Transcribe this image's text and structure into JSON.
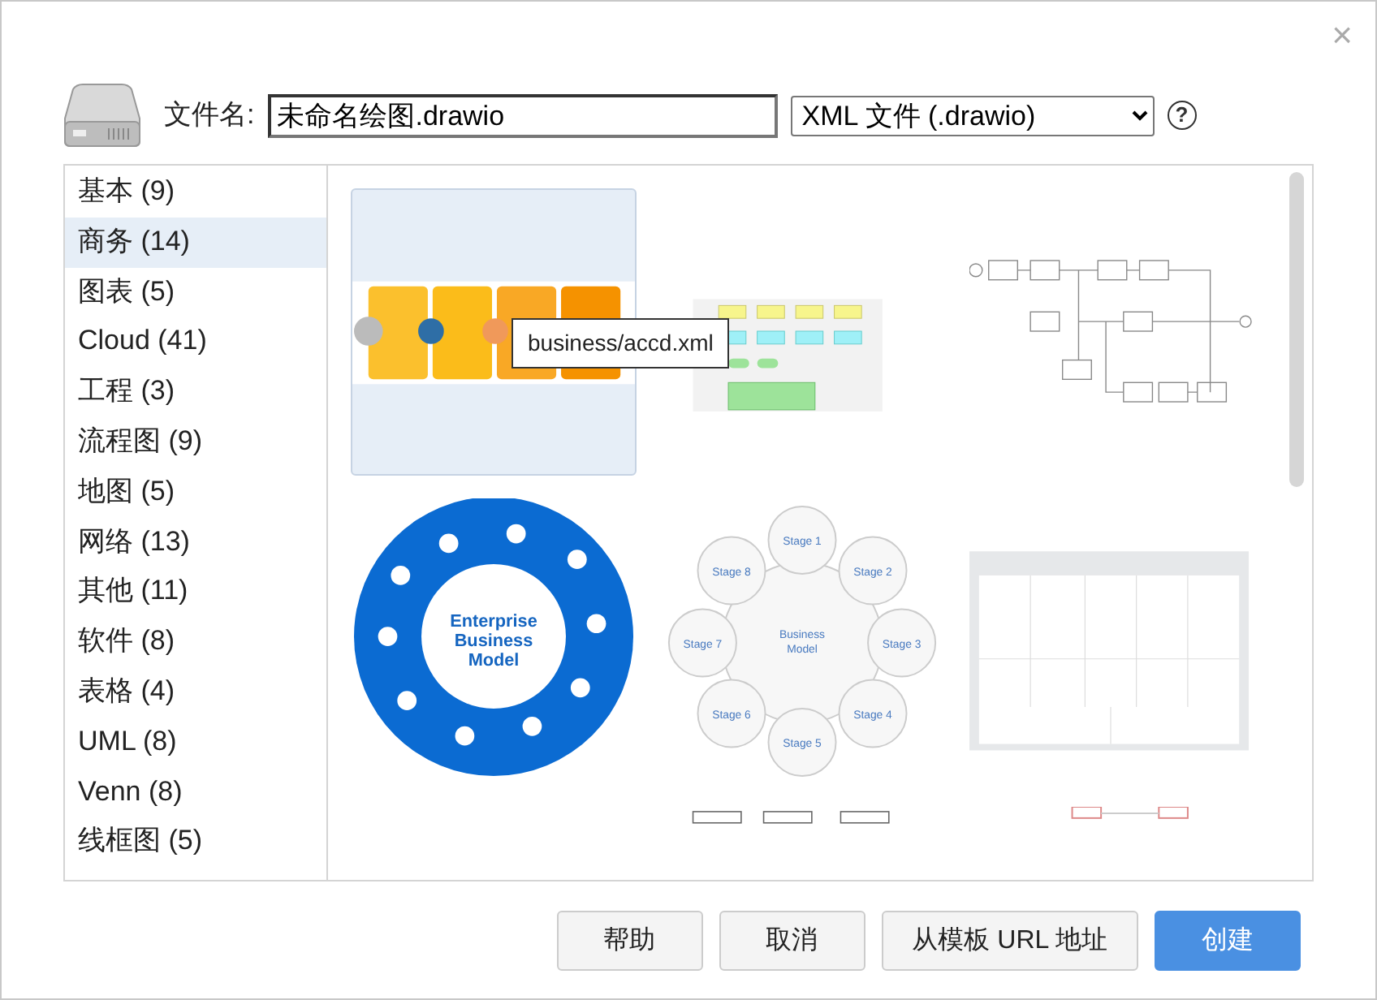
{
  "dialog": {
    "close": "×"
  },
  "file": {
    "label": "文件名:",
    "value": "未命名绘图.drawio",
    "format": "XML 文件 (.drawio)",
    "help": "?"
  },
  "categories": [
    {
      "label": "基本 (9)",
      "selected": false
    },
    {
      "label": "商务 (14)",
      "selected": true
    },
    {
      "label": "图表 (5)",
      "selected": false
    },
    {
      "label": "Cloud (41)",
      "selected": false
    },
    {
      "label": "工程 (3)",
      "selected": false
    },
    {
      "label": "流程图 (9)",
      "selected": false
    },
    {
      "label": "地图 (5)",
      "selected": false
    },
    {
      "label": "网络 (13)",
      "selected": false
    },
    {
      "label": "其他 (11)",
      "selected": false
    },
    {
      "label": "软件 (8)",
      "selected": false
    },
    {
      "label": "表格 (4)",
      "selected": false
    },
    {
      "label": "UML (8)",
      "selected": false
    },
    {
      "label": "Venn (8)",
      "selected": false
    },
    {
      "label": "线框图 (5)",
      "selected": false
    }
  ],
  "templates": [
    {
      "kind": "chevron",
      "selected": true
    },
    {
      "kind": "swimlane",
      "selected": false
    },
    {
      "kind": "bpmn",
      "selected": false
    },
    {
      "kind": "ring",
      "selected": false,
      "texts": [
        "Enterprise",
        "Business",
        "Model"
      ]
    },
    {
      "kind": "cycle",
      "selected": false,
      "texts": [
        "Stage 1",
        "Stage 8",
        "Stage 2",
        "Stage 7",
        "Business",
        "Model",
        "Stage 3",
        "Stage 6",
        "Stage 4",
        "Stage 5"
      ]
    },
    {
      "kind": "canvas",
      "selected": false
    },
    {
      "kind": "cells",
      "selected": false
    },
    {
      "kind": "links",
      "selected": false
    }
  ],
  "tooltip": "business/accd.xml",
  "buttons": [
    {
      "label": "帮助",
      "kind": "default"
    },
    {
      "label": "取消",
      "kind": "default"
    },
    {
      "label": "从模板 URL 地址",
      "kind": "default"
    },
    {
      "label": "创建",
      "kind": "primary"
    }
  ]
}
